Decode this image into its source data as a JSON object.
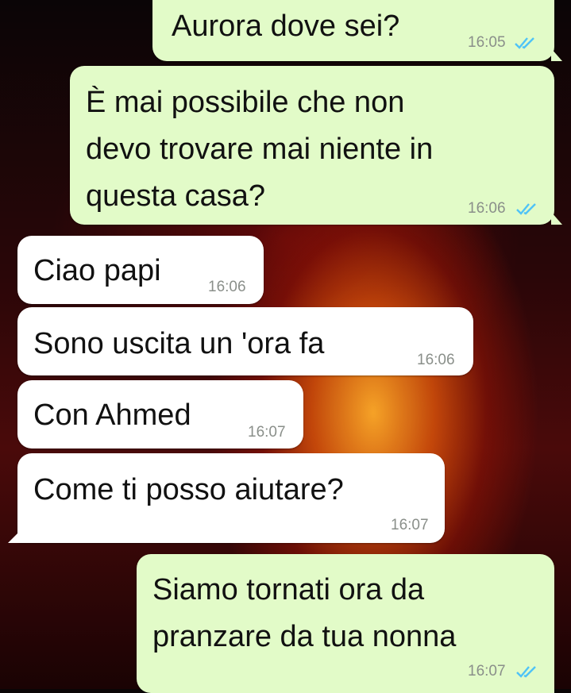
{
  "messages": [
    {
      "direction": "outgoing",
      "text": "Aurora dove sei?",
      "time": "16:05",
      "status": "read"
    },
    {
      "direction": "outgoing",
      "lines": [
        "È mai possibile che non",
        "devo trovare mai niente in",
        "questa casa?"
      ],
      "time": "16:06",
      "status": "read"
    },
    {
      "direction": "incoming",
      "text": "Ciao papi",
      "time": "16:06"
    },
    {
      "direction": "incoming",
      "text": "Sono uscita un 'ora fa",
      "time": "16:06"
    },
    {
      "direction": "incoming",
      "text": "Con Ahmed",
      "time": "16:07"
    },
    {
      "direction": "incoming",
      "text": "Come ti posso aiutare?",
      "time": "16:07"
    },
    {
      "direction": "outgoing",
      "lines": [
        "Siamo tornati ora da",
        "pranzare da tua nonna"
      ],
      "time": "16:07",
      "status": "read"
    }
  ],
  "colors": {
    "outgoing_bubble": "#e2fbc8",
    "incoming_bubble": "#ffffff",
    "read_ticks": "#4fc3f7",
    "timestamp": "#8a8f8a"
  },
  "icons": {
    "read_receipt": "double-check-icon"
  }
}
